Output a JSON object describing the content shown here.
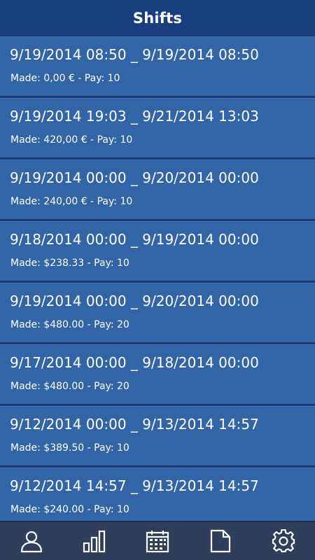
{
  "header": {
    "title": "Shifts"
  },
  "shifts": [
    {
      "range": "9/19/2014 08:50 _ 9/19/2014 08:50",
      "summary": "Made: 0,00 € - Pay: 10"
    },
    {
      "range": "9/19/2014 19:03 _ 9/21/2014 13:03",
      "summary": "Made: 420,00 € - Pay: 10"
    },
    {
      "range": "9/19/2014 00:00 _ 9/20/2014 00:00",
      "summary": "Made: 240,00 € - Pay: 10"
    },
    {
      "range": "9/18/2014 00:00 _ 9/19/2014 00:00",
      "summary": "Made: $238.33 - Pay: 10"
    },
    {
      "range": "9/19/2014 00:00 _ 9/20/2014 00:00",
      "summary": "Made: $480.00 - Pay: 20"
    },
    {
      "range": "9/17/2014 00:00 _ 9/18/2014 00:00",
      "summary": "Made: $480.00 - Pay: 20"
    },
    {
      "range": "9/12/2014 00:00 _ 9/13/2014 14:57",
      "summary": "Made: $389.50 - Pay: 10"
    },
    {
      "range": "9/12/2014 14:57 _ 9/13/2014 14:57",
      "summary": "Made: $240.00 - Pay: 10"
    }
  ],
  "nav": [
    {
      "icon": "user-icon"
    },
    {
      "icon": "bar-chart-icon"
    },
    {
      "icon": "calendar-icon"
    },
    {
      "icon": "document-icon"
    },
    {
      "icon": "gear-icon"
    }
  ],
  "colors": {
    "header": "#1a3f80",
    "list_item": "#3165a8",
    "separator": "#1d3b68",
    "nav_bar": "#2e3f5c",
    "text": "#ffffff"
  }
}
